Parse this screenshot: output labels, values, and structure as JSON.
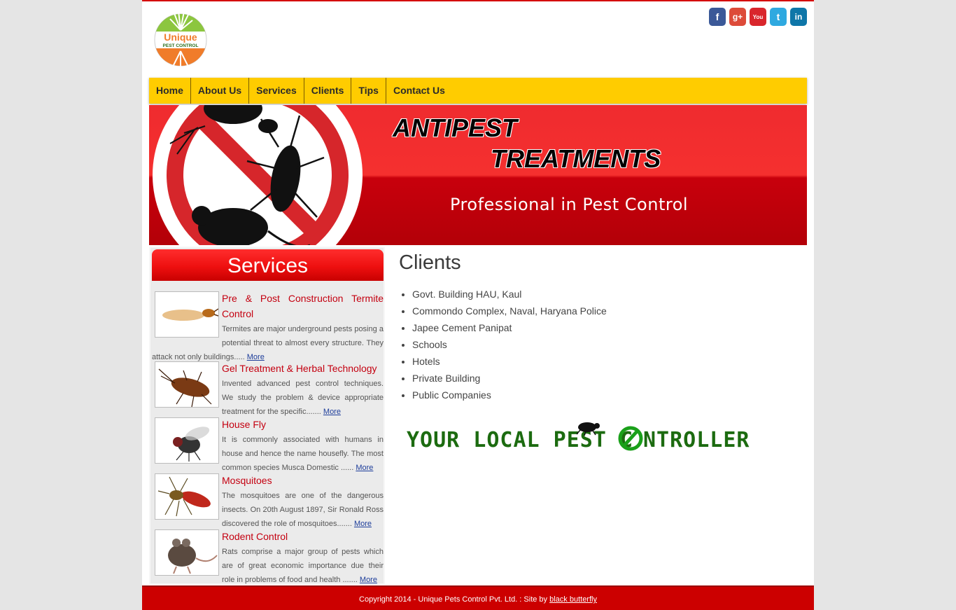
{
  "header": {
    "logo_top": "Unique",
    "logo_bottom": "PEST CONTROL",
    "social": [
      {
        "name": "facebook",
        "glyph": "f",
        "color": "#3b5998"
      },
      {
        "name": "google-plus",
        "glyph": "g+",
        "color": "#dd4b39"
      },
      {
        "name": "youtube",
        "glyph": "You",
        "color": "#d9262c"
      },
      {
        "name": "twitter",
        "glyph": "t",
        "color": "#2fa9e0"
      },
      {
        "name": "linkedin",
        "glyph": "in",
        "color": "#0e76a8"
      }
    ]
  },
  "nav": {
    "items": [
      "Home",
      "About Us",
      "Services",
      "Clients",
      "Tips",
      "Contact Us"
    ]
  },
  "banner": {
    "line1": "ANTIPEST",
    "line2": "TREATMENTS",
    "tagline": "Professional in Pest Control"
  },
  "sidebar": {
    "heading": "Services",
    "more_label": "More",
    "items": [
      {
        "title": "Pre & Post Construction Termite Control",
        "text": "Termites are major underground pests posing a potential threat to almost every structure. They attack not only buildings.....",
        "icon": "termite-icon"
      },
      {
        "title": "Gel Treatment & Herbal Technology",
        "text": "Invented advanced pest control techniques. We study the problem & device appropriate treatment for the specific.......",
        "icon": "cockroach-icon"
      },
      {
        "title": "House Fly",
        "text": "It is commonly associated with humans in house and hence the name housefly. The most common species Musca Domestic ......",
        "icon": "fly-icon"
      },
      {
        "title": "Mosquitoes",
        "text": "The mosquitoes are one of the dangerous insects. On 20th August 1897, Sir Ronald Ross discovered the role of mosquitoes.......",
        "icon": "mosquito-icon"
      },
      {
        "title": "Rodent Control",
        "text": "Rats comprise a major group of pests which are of great economic importance due their role in problems of food and health .......",
        "icon": "rat-icon"
      }
    ]
  },
  "main": {
    "title": "Clients",
    "clients": [
      "Govt. Building HAU, Kaul",
      "Commondo Complex, Naval, Haryana Police",
      "Japee Cement Panipat",
      "Schools",
      "Hotels",
      "Private Building",
      "Public Companies"
    ],
    "slogan_part1": "YOUR LOCAL PEST C",
    "slogan_part2": "NTROLLER"
  },
  "footer": {
    "copyright": "Copyright 2014 - Unique Pets Control Pvt. Ltd. : Site by ",
    "credit": "black butterfly"
  },
  "colors": {
    "nav_bg": "#ffcc00",
    "accent_red": "#cc0000",
    "slogan_green": "#1c6b10"
  }
}
